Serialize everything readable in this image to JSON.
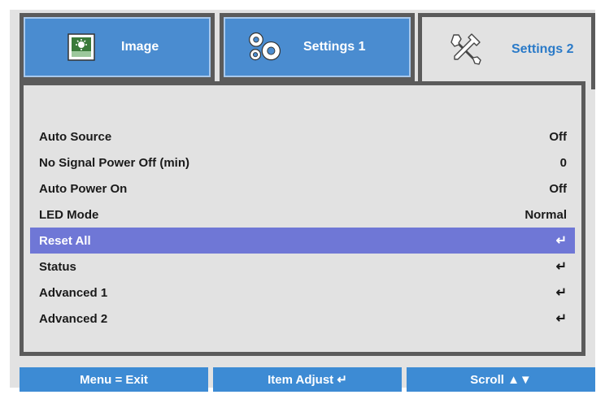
{
  "tabs": [
    {
      "label": "Image",
      "icon": "image-icon",
      "active": false
    },
    {
      "label": "Settings 1",
      "icon": "gears-icon",
      "active": false
    },
    {
      "label": "Settings 2",
      "icon": "tools-icon",
      "active": true
    }
  ],
  "menu": {
    "rows": [
      {
        "label": "Auto Source",
        "value": "Off"
      },
      {
        "label": "No Signal Power Off (min)",
        "value": "0"
      },
      {
        "label": "Auto Power On",
        "value": "Off"
      },
      {
        "label": "LED Mode",
        "value": "Normal"
      },
      {
        "label": "Reset All",
        "value": "↵",
        "selected": true
      },
      {
        "label": "Status",
        "value": "↵"
      },
      {
        "label": "Advanced 1",
        "value": "↵"
      },
      {
        "label": "Advanced 2",
        "value": "↵"
      }
    ]
  },
  "footer": {
    "menu_exit": "Menu = Exit",
    "item_adjust": "Item Adjust ↵",
    "scroll": "Scroll ▲▼"
  },
  "colors": {
    "tab_blue": "#4a8cd0",
    "frame_gray": "#5b5b5b",
    "selected_row": "#6f77d6",
    "active_tab_text": "#2a7ac8",
    "footer_blue": "#3d8bd4"
  }
}
